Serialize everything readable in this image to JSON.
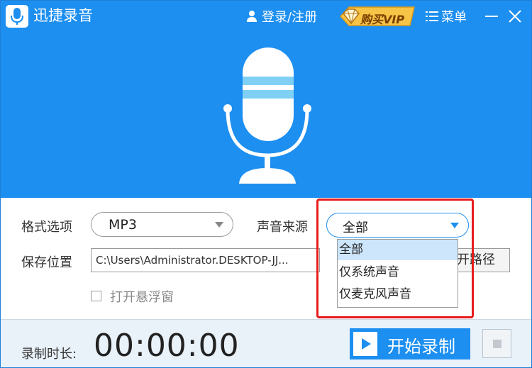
{
  "app": {
    "title": "迅捷录音"
  },
  "header": {
    "login_label": "登录/注册",
    "vip_label": "购买VIP",
    "menu_label": "菜单"
  },
  "settings": {
    "format_label": "格式选项",
    "format_value": "MP3",
    "source_label": "声音来源",
    "source_value": "全部",
    "source_options": [
      "全部",
      "仅系统声音",
      "仅麦克风声音"
    ],
    "source_selected_index": 0,
    "save_label": "保存位置",
    "save_path": "C:\\Users\\Administrator.DESKTOP-JJ...",
    "open_path_label": "开路径",
    "float_window_label": "打开悬浮窗",
    "float_window_checked": false
  },
  "footer": {
    "duration_label": "录制时长:",
    "duration_value": "00:00:00",
    "start_label": "开始录制"
  },
  "colors": {
    "brand_blue": "#1d8ff0",
    "highlight_red": "#e81c1c",
    "vip_gold": "#f6c446"
  },
  "icons": [
    "app-logo-mic-icon",
    "user-icon",
    "vip-diamond-icon",
    "menu-icon",
    "minimize-icon",
    "close-icon",
    "microphone-icon",
    "chevron-down-icon",
    "play-icon",
    "stop-icon"
  ]
}
